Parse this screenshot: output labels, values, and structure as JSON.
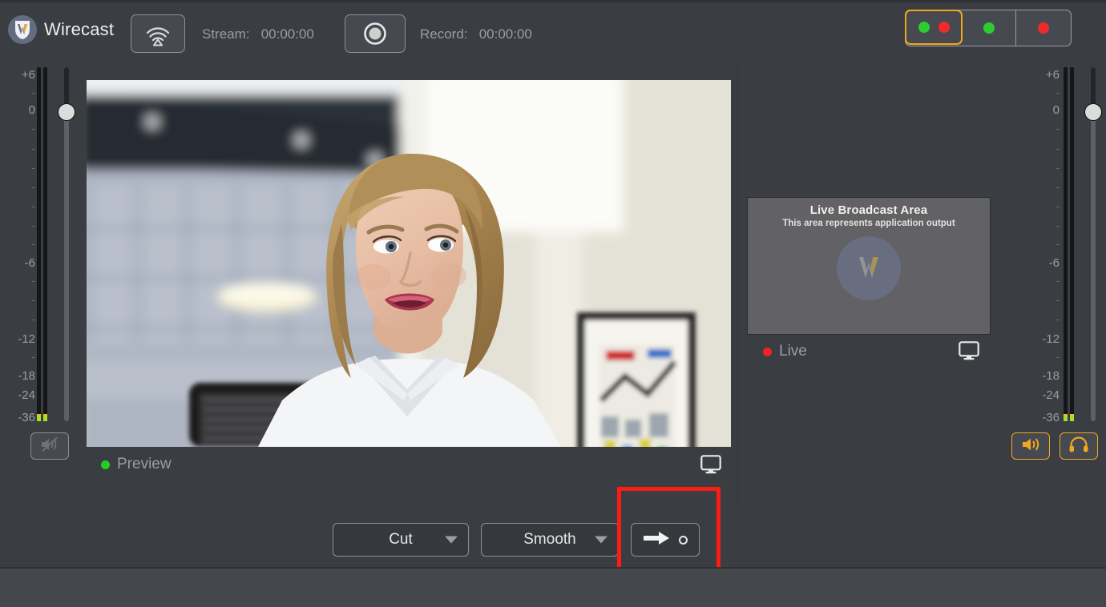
{
  "app": {
    "name": "Wirecast",
    "logo_icon": "wirecast-shield-logo"
  },
  "toolbar": {
    "stream_button_icon": "broadcast-wifi-icon",
    "stream_label": "Stream:",
    "stream_time": "00:00:00",
    "record_button_icon": "record-circle-icon",
    "record_label": "Record:",
    "record_time": "00:00:00",
    "led_groups": [
      {
        "name": "stream-and-record-indicator",
        "dots": [
          "green",
          "red"
        ],
        "selected": true
      },
      {
        "name": "stream-indicator",
        "dots": [
          "green"
        ],
        "selected": false
      },
      {
        "name": "record-indicator",
        "dots": [
          "red"
        ],
        "selected": false
      }
    ]
  },
  "meters": {
    "scale_major": [
      "+6",
      "0",
      "-6",
      "-12",
      "-18",
      "-24",
      "-36"
    ],
    "left": {
      "mute_button_icon": "speaker-muted-icon",
      "mute_active": false
    },
    "right": {
      "speaker_button_icon": "speaker-on-icon",
      "headphones_button_icon": "headphones-icon",
      "accent": true
    }
  },
  "preview": {
    "status_label": "Preview",
    "status_color": "#23cf23",
    "monitor_icon": "display-monitor-icon"
  },
  "live": {
    "title": "Live Broadcast Area",
    "subtitle": "This area represents application output",
    "watermark_icon": "wirecast-shield-watermark",
    "status_label": "Live",
    "status_color": "#ee2424",
    "monitor_icon": "display-monitor-icon"
  },
  "transition": {
    "cut_label": "Cut",
    "smooth_label": "Smooth",
    "go_button_icon": "arrow-right-go-icon",
    "go_button_indicator_icon": "circle-outline-icon",
    "annotation_color": "#fc1c12"
  },
  "colors": {
    "window_bg": "#3a3d42",
    "footer_bg": "#44474c",
    "accent_orange": "#f0a81e",
    "text_muted": "#9a9da3",
    "led_green": "#2ecc2e",
    "led_red": "#ef2b2b"
  }
}
